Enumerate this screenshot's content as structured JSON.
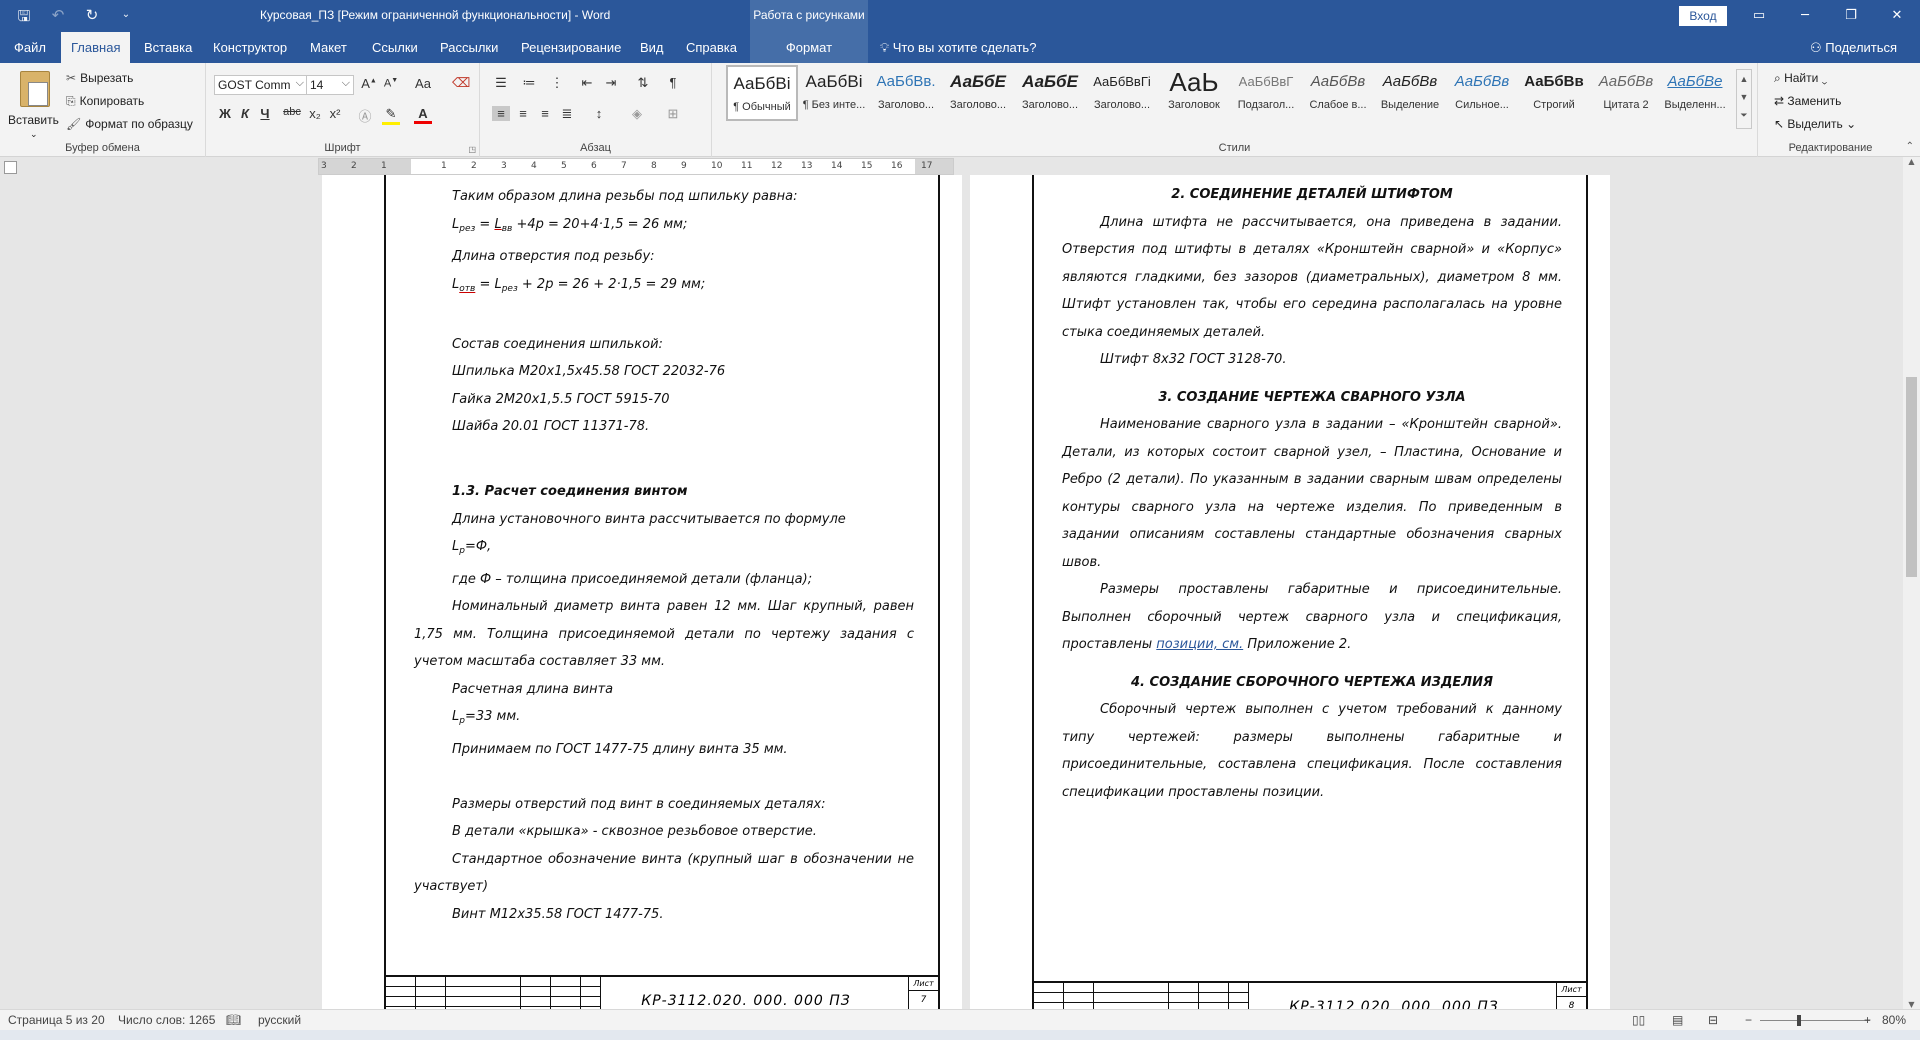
{
  "titlebar": {
    "title": "Курсовая_ПЗ [Режим ограниченной функциональности]  -  Word",
    "context_label": "Работа с рисунками",
    "login": "Вход",
    "icons": [
      "save-icon",
      "undo-icon",
      "redo-icon",
      "customize-qat-icon"
    ]
  },
  "tabs": {
    "items": [
      "Файл",
      "Главная",
      "Вставка",
      "Конструктор",
      "Макет",
      "Ссылки",
      "Рассылки",
      "Рецензирование",
      "Вид",
      "Справка"
    ],
    "context_tab": "Формат",
    "tellme": "Что вы хотите сделать?",
    "share": "Поделиться"
  },
  "ribbon": {
    "clipboard": {
      "label": "Буфер обмена",
      "paste": "Вставить",
      "cut": "Вырезать",
      "copy": "Копировать",
      "format_painter": "Формат по образцу"
    },
    "font": {
      "label": "Шрифт",
      "name": "GOST Comm",
      "size": "14",
      "case": "Aa",
      "bold": "Ж",
      "italic": "К",
      "underline": "Ч",
      "strike": "abc",
      "subscript": "x₂",
      "superscript": "x²"
    },
    "paragraph": {
      "label": "Абзац"
    },
    "styles": {
      "label": "Стили",
      "items": [
        {
          "preview": "АаБбВі",
          "name": "¶ Обычный"
        },
        {
          "preview": "АаБбВі",
          "name": "¶ Без инте..."
        },
        {
          "preview": "АаБбВв.",
          "name": "Заголово..."
        },
        {
          "preview": "АаБбЕ",
          "name": "Заголово..."
        },
        {
          "preview": "АаБбЕ",
          "name": "Заголово..."
        },
        {
          "preview": "АаБбВвГі",
          "name": "Заголово..."
        },
        {
          "preview": "АаЬ",
          "name": "Заголовок"
        },
        {
          "preview": "АаБбВвГ",
          "name": "Подзагол..."
        },
        {
          "preview": "АаБбВв",
          "name": "Слабое в..."
        },
        {
          "preview": "АаБбВв",
          "name": "Выделение"
        },
        {
          "preview": "АаБбВв",
          "name": "Сильное..."
        },
        {
          "preview": "АаБбВв",
          "name": "Строгий"
        },
        {
          "preview": "АаБбВв",
          "name": "Цитата 2"
        },
        {
          "preview": "АаБбВе",
          "name": "Выделенн..."
        }
      ]
    },
    "editing": {
      "label": "Редактирование",
      "find": "Найти",
      "replace": "Заменить",
      "select": "Выделить"
    }
  },
  "ruler": {
    "numbers": [
      "3",
      "2",
      "1",
      "1",
      "2",
      "3",
      "4",
      "5",
      "6",
      "7",
      "8",
      "9",
      "10",
      "11",
      "12",
      "13",
      "14",
      "15",
      "16",
      "17"
    ]
  },
  "page_left": {
    "p1": "Таким образом длина резьбы под шпильку равна:",
    "p2_a": "L",
    "p2_sub1": "рез",
    "p2_b": " = ",
    "p2_c": "L",
    "p2_sub2": "вв",
    "p2_d": " +4p = 20+4·1,5 = 26 мм;",
    "p3": "Длина отверстия под резьбу:",
    "p4_a": "L",
    "p4_sub1": "отв",
    "p4_b": " = L",
    "p4_sub2": "рез",
    "p4_c": " + 2p = 26 + 2·1,5 = 29 мм;",
    "p5": "Состав соединения шпилькой:",
    "p6": "Шпилька М20х1,5х45.58 ГОСТ 22032-76",
    "p7": "Гайка 2М20х1,5.5 ГОСТ 5915-70",
    "p8": "Шайба 20.01 ГОСТ 11371-78.",
    "h1": "1.3. Расчет соединения винтом",
    "p9": "Длина установочного винта рассчитывается по формуле",
    "p10_a": "L",
    "p10_sub": "р",
    "p10_b": "=Ф,",
    "p11": "где Ф – толщина присоединяемой детали (фланца);",
    "p12": "Номинальный диаметр винта равен 12 мм. Шаг крупный, равен 1,75 мм. Толщина присоединяемой детали по чертежу задания с учетом масштаба составляет 33 мм.",
    "p13": "Расчетная длина винта",
    "p14_a": "L",
    "p14_sub": "р",
    "p14_b": "=33 мм.",
    "p15": "Принимаем по ГОСТ 1477-75 длину винта 35 мм.",
    "p16": "Размеры отверстий  под винт в соединяемых деталях:",
    "p17": "В детали «крышка» - сквозное резьбовое отверстие.",
    "p18": "Стандартное обозначение винта (крупный шаг в обозначении не участвует)",
    "p19": "Винт М12х35.58 ГОСТ 1477-75.",
    "stamp_code": "КР-3112.020. 000. 000 ПЗ",
    "stamp_list": "Лист",
    "stamp_num": "7"
  },
  "page_right": {
    "h2": "2. СОЕДИНЕНИЕ ДЕТАЛЕЙ ШТИФТОМ",
    "p1": "Длина штифта не рассчитывается, она приведена в задании. Отверстия под штифты в деталях «Кронштейн сварной» и «Корпус» являются гладкими, без зазоров (диаметральных), диаметром 8 мм. Штифт установлен так, чтобы его середина располагалась на уровне стыка соединяемых деталей.",
    "p2": "Штифт 8х32 ГОСТ 3128-70.",
    "h3": "3. СОЗДАНИЕ ЧЕРТЕЖА СВАРНОГО УЗЛА",
    "p3": "Наименование сварного узла в задании – «Кронштейн сварной». Детали, из которых состоит сварной узел, – Пластина, Основание и Ребро (2 детали). По указанным в задании сварным швам определены контуры сварного узла на чертеже изделия. По приведенным в задании описаниям составлены стандартные обозначения сварных швов.",
    "p4_a": "Размеры проставлены габаритные и присоединительные. Выполнен сборочный чертеж сварного узла и спецификация, проставлены ",
    "p4_link": "позиции, см.",
    "p4_b": " Приложение 2.",
    "h4": "4. СОЗДАНИЕ СБОРОЧНОГО ЧЕРТЕЖА ИЗДЕЛИЯ",
    "p5": "Сборочный чертеж выполнен с учетом требований к данному типу чертежей: размеры выполнены габаритные и присоединительные, составлена спецификация. После составления спецификации проставлены позиции.",
    "stamp_code": "КР-3112.020. 000. 000 ПЗ",
    "stamp_list": "Лист",
    "stamp_num": "8"
  },
  "statusbar": {
    "page": "Страница 5 из 20",
    "words": "Число слов: 1265",
    "lang": "русский",
    "zoom": "80%",
    "zoom_level": 0.8
  }
}
